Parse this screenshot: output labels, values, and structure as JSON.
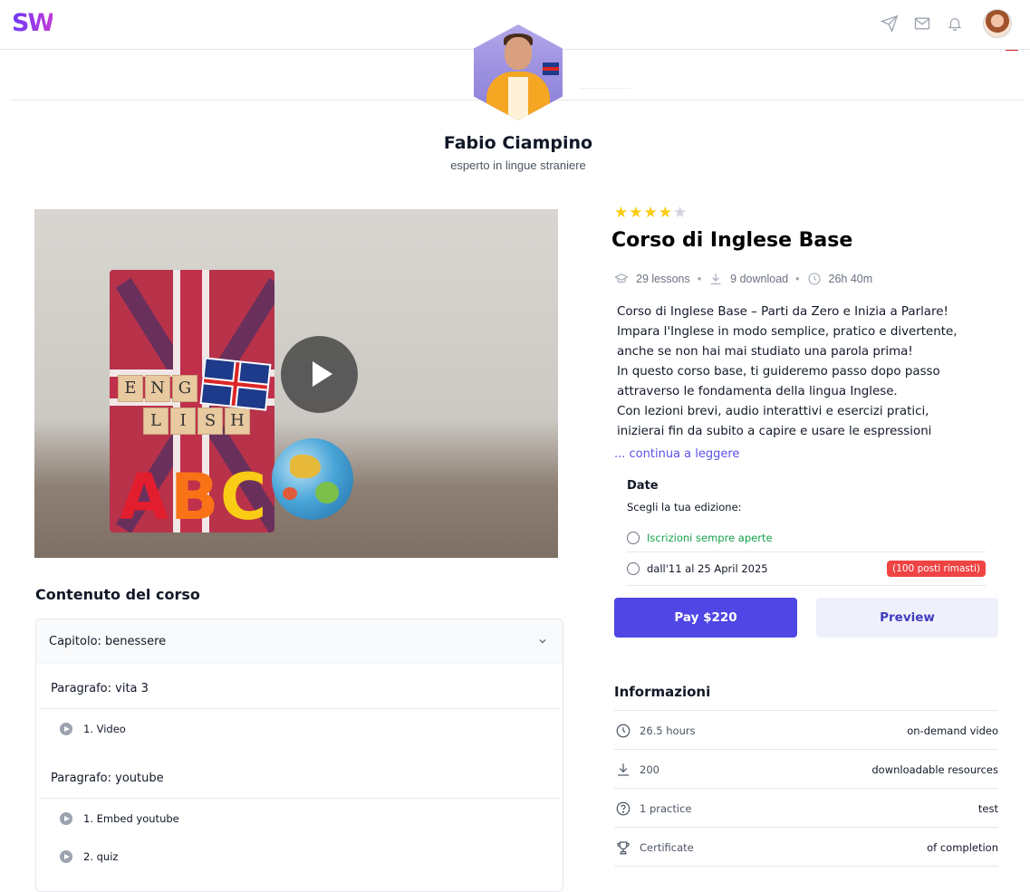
{
  "header": {
    "logo": "SW",
    "icons": [
      "send-icon",
      "mail-icon",
      "bell-icon"
    ]
  },
  "instructor": {
    "name": "Fabio Ciampino",
    "role": "esperto in lingue straniere"
  },
  "video": {
    "tiles_row1": [
      "E",
      "N",
      "G"
    ],
    "tiles_row2": [
      "L",
      "I",
      "S",
      "H"
    ],
    "abc": [
      "A",
      "B",
      "C"
    ]
  },
  "course": {
    "rating": 4,
    "rating_max": 5,
    "title": "Corso di Inglese Base",
    "lessons": "29 lessons",
    "downloads": "9 download",
    "duration": "26h 40m",
    "description_lines": [
      "Corso di Inglese Base – Parti da Zero e Inizia a Parlare!",
      "Impara l'Inglese in modo semplice, pratico e divertente,",
      "anche se non hai mai studiato una parola prima!",
      "In questo corso base, ti guideremo passo dopo passo",
      "attraverso le fondamenta della lingua Inglese.",
      "Con lezioni brevi, audio interattivi e esercizi pratici,",
      "inizierai fin da subito a capire e usare le espressioni"
    ],
    "read_more": "... continua a leggere"
  },
  "content": {
    "title": "Contenuto del corso",
    "chapter": "Capitolo: benessere",
    "paragraphs": [
      {
        "title": "Paragrafo: vita 3",
        "lessons": [
          "1. Video"
        ]
      },
      {
        "title": "Paragrafo: youtube",
        "lessons": [
          "1. Embed youtube",
          "2. quiz"
        ]
      }
    ]
  },
  "dates": {
    "title": "Date",
    "subtitle": "Scegli la tua edizione:",
    "options": [
      {
        "label": "Iscrizioni sempre aperte",
        "color": "#16a34a",
        "badge": ""
      },
      {
        "label": "dall'11 al 25 April 2025",
        "color": "#111827",
        "badge": "(100 posti rimasti)"
      }
    ]
  },
  "actions": {
    "pay": "Pay $220",
    "preview": "Preview"
  },
  "info": {
    "title": "Informazioni",
    "rows": [
      {
        "icon": "clock-icon",
        "value": "26.5 hours",
        "right": "on-demand video"
      },
      {
        "icon": "download-icon",
        "value": "200",
        "right": "downloadable resources"
      },
      {
        "icon": "question-icon",
        "value": "1 practice",
        "right": "test"
      },
      {
        "icon": "trophy-icon",
        "value": "Certificate",
        "right": "of completion"
      }
    ]
  },
  "colors": {
    "accent": "#4f46e5",
    "star": "#facc15",
    "badge": "#ef4444",
    "open_green": "#16a34a"
  }
}
